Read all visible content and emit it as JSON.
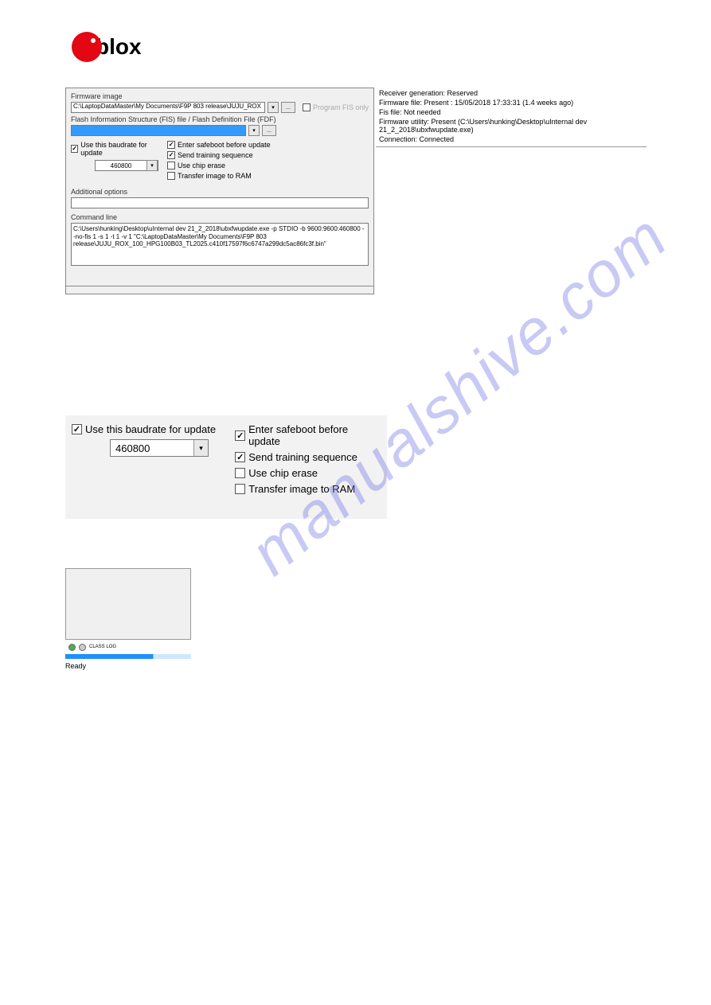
{
  "logo": {
    "text": "blox"
  },
  "watermark": "manualshive.com",
  "dialog1": {
    "firmware_image_label": "Firmware image",
    "firmware_image_path": "C:\\LaptopDataMaster\\My Documents\\F9P 803 release\\JUJU_ROX",
    "program_fis_only": "Program FIS only",
    "fis_label": "Flash Information Structure (FIS) file / Flash Definition File (FDF)",
    "use_baudrate_label": "Use this baudrate for update",
    "baudrate_value": "460800",
    "enter_safeboot": "Enter safeboot before update",
    "send_training": "Send training sequence",
    "use_chip_erase": "Use chip erase",
    "transfer_to_ram": "Transfer image to RAM",
    "additional_options_label": "Additional options",
    "command_line_label": "Command line",
    "command_line_text": "C:\\Users\\hunking\\Desktop\\uInternal dev 21_2_2018\\ubxfwupdate.exe -p STDIO -b 9600:9600:460800 --no-fis 1 -s 1 -t 1 -v 1 \"C:\\LaptopDataMaster\\My Documents\\F9P 803 release\\JUJU_ROX_100_HPG100B03_TL2025.c410f17597f6c6747a299dc5ac86fc3f.bin\""
  },
  "right": {
    "receiver_gen": "Receiver generation: Reserved",
    "firmware_file": "Firmware file: Present : 15/05/2018  17:33:31 (1.4 weeks ago)",
    "fis_file": "Fis file: Not needed",
    "firmware_utility": "Firmware utility: Present (C:\\Users\\hunking\\Desktop\\uInternal dev 21_2_2018\\ubxfwupdate.exe)",
    "connection": "Connection: Connected"
  },
  "dialog2": {
    "use_baudrate_label": "Use this baudrate for update",
    "baudrate_value": "460800",
    "enter_safeboot": "Enter safeboot before update",
    "send_training": "Send training sequence",
    "use_chip_erase": "Use chip erase",
    "transfer_to_ram": "Transfer image to RAM"
  },
  "dialog3": {
    "status_label": "CLASS\nLOG",
    "ready": "Ready"
  }
}
